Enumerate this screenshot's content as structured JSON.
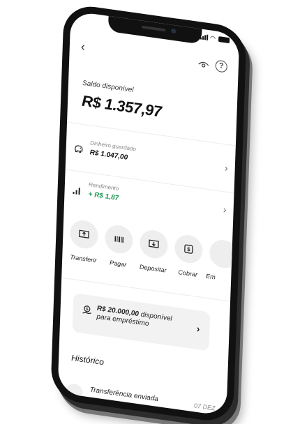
{
  "header": {
    "back_icon": "chevron-left-icon",
    "visibility_icon": "eye-icon",
    "help_symbol": "?"
  },
  "balance": {
    "label": "Saldo disponível",
    "value": "R$ 1.357,97"
  },
  "savings": {
    "label": "Dinheiro guardado",
    "value": "R$ 1.047,00",
    "chevron": "›"
  },
  "yield": {
    "label": "Rendimento",
    "value": "+ R$ 1,87",
    "chevron": "›"
  },
  "actions": [
    {
      "label": "Transferir",
      "icon": "transfer-icon"
    },
    {
      "label": "Pagar",
      "icon": "barcode-icon"
    },
    {
      "label": "Depositar",
      "icon": "deposit-icon"
    },
    {
      "label": "Cobrar",
      "icon": "charge-icon"
    },
    {
      "label": "Em",
      "icon": "more-icon"
    }
  ],
  "loan": {
    "amount": "R$ 20.000,00",
    "suffix": "disponível",
    "line2": "para empréstimo",
    "chevron": "›"
  },
  "history": {
    "title": "Histórico",
    "items": [
      {
        "title": "Transferência enviada",
        "date": "07 DEZ"
      }
    ]
  },
  "colors": {
    "accent_green": "#1f9a57",
    "text_dark": "#111111",
    "card_bg": "#f2f2f2"
  }
}
